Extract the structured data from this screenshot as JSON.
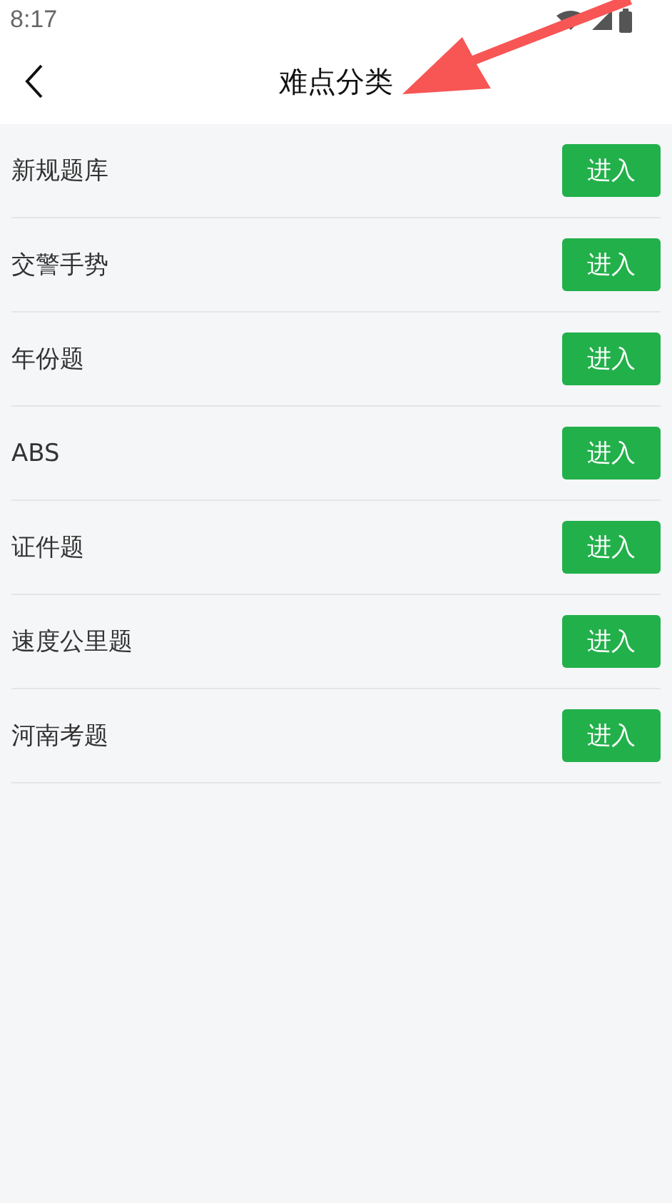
{
  "status_bar": {
    "time": "8:17"
  },
  "header": {
    "title": "难点分类"
  },
  "items": [
    {
      "label": "新规题库",
      "button": "进入"
    },
    {
      "label": "交警手势",
      "button": "进入"
    },
    {
      "label": "年份题",
      "button": "进入"
    },
    {
      "label": "ABS",
      "button": "进入"
    },
    {
      "label": "证件题",
      "button": "进入"
    },
    {
      "label": "速度公里题",
      "button": "进入"
    },
    {
      "label": "河南考题",
      "button": "进入"
    }
  ]
}
